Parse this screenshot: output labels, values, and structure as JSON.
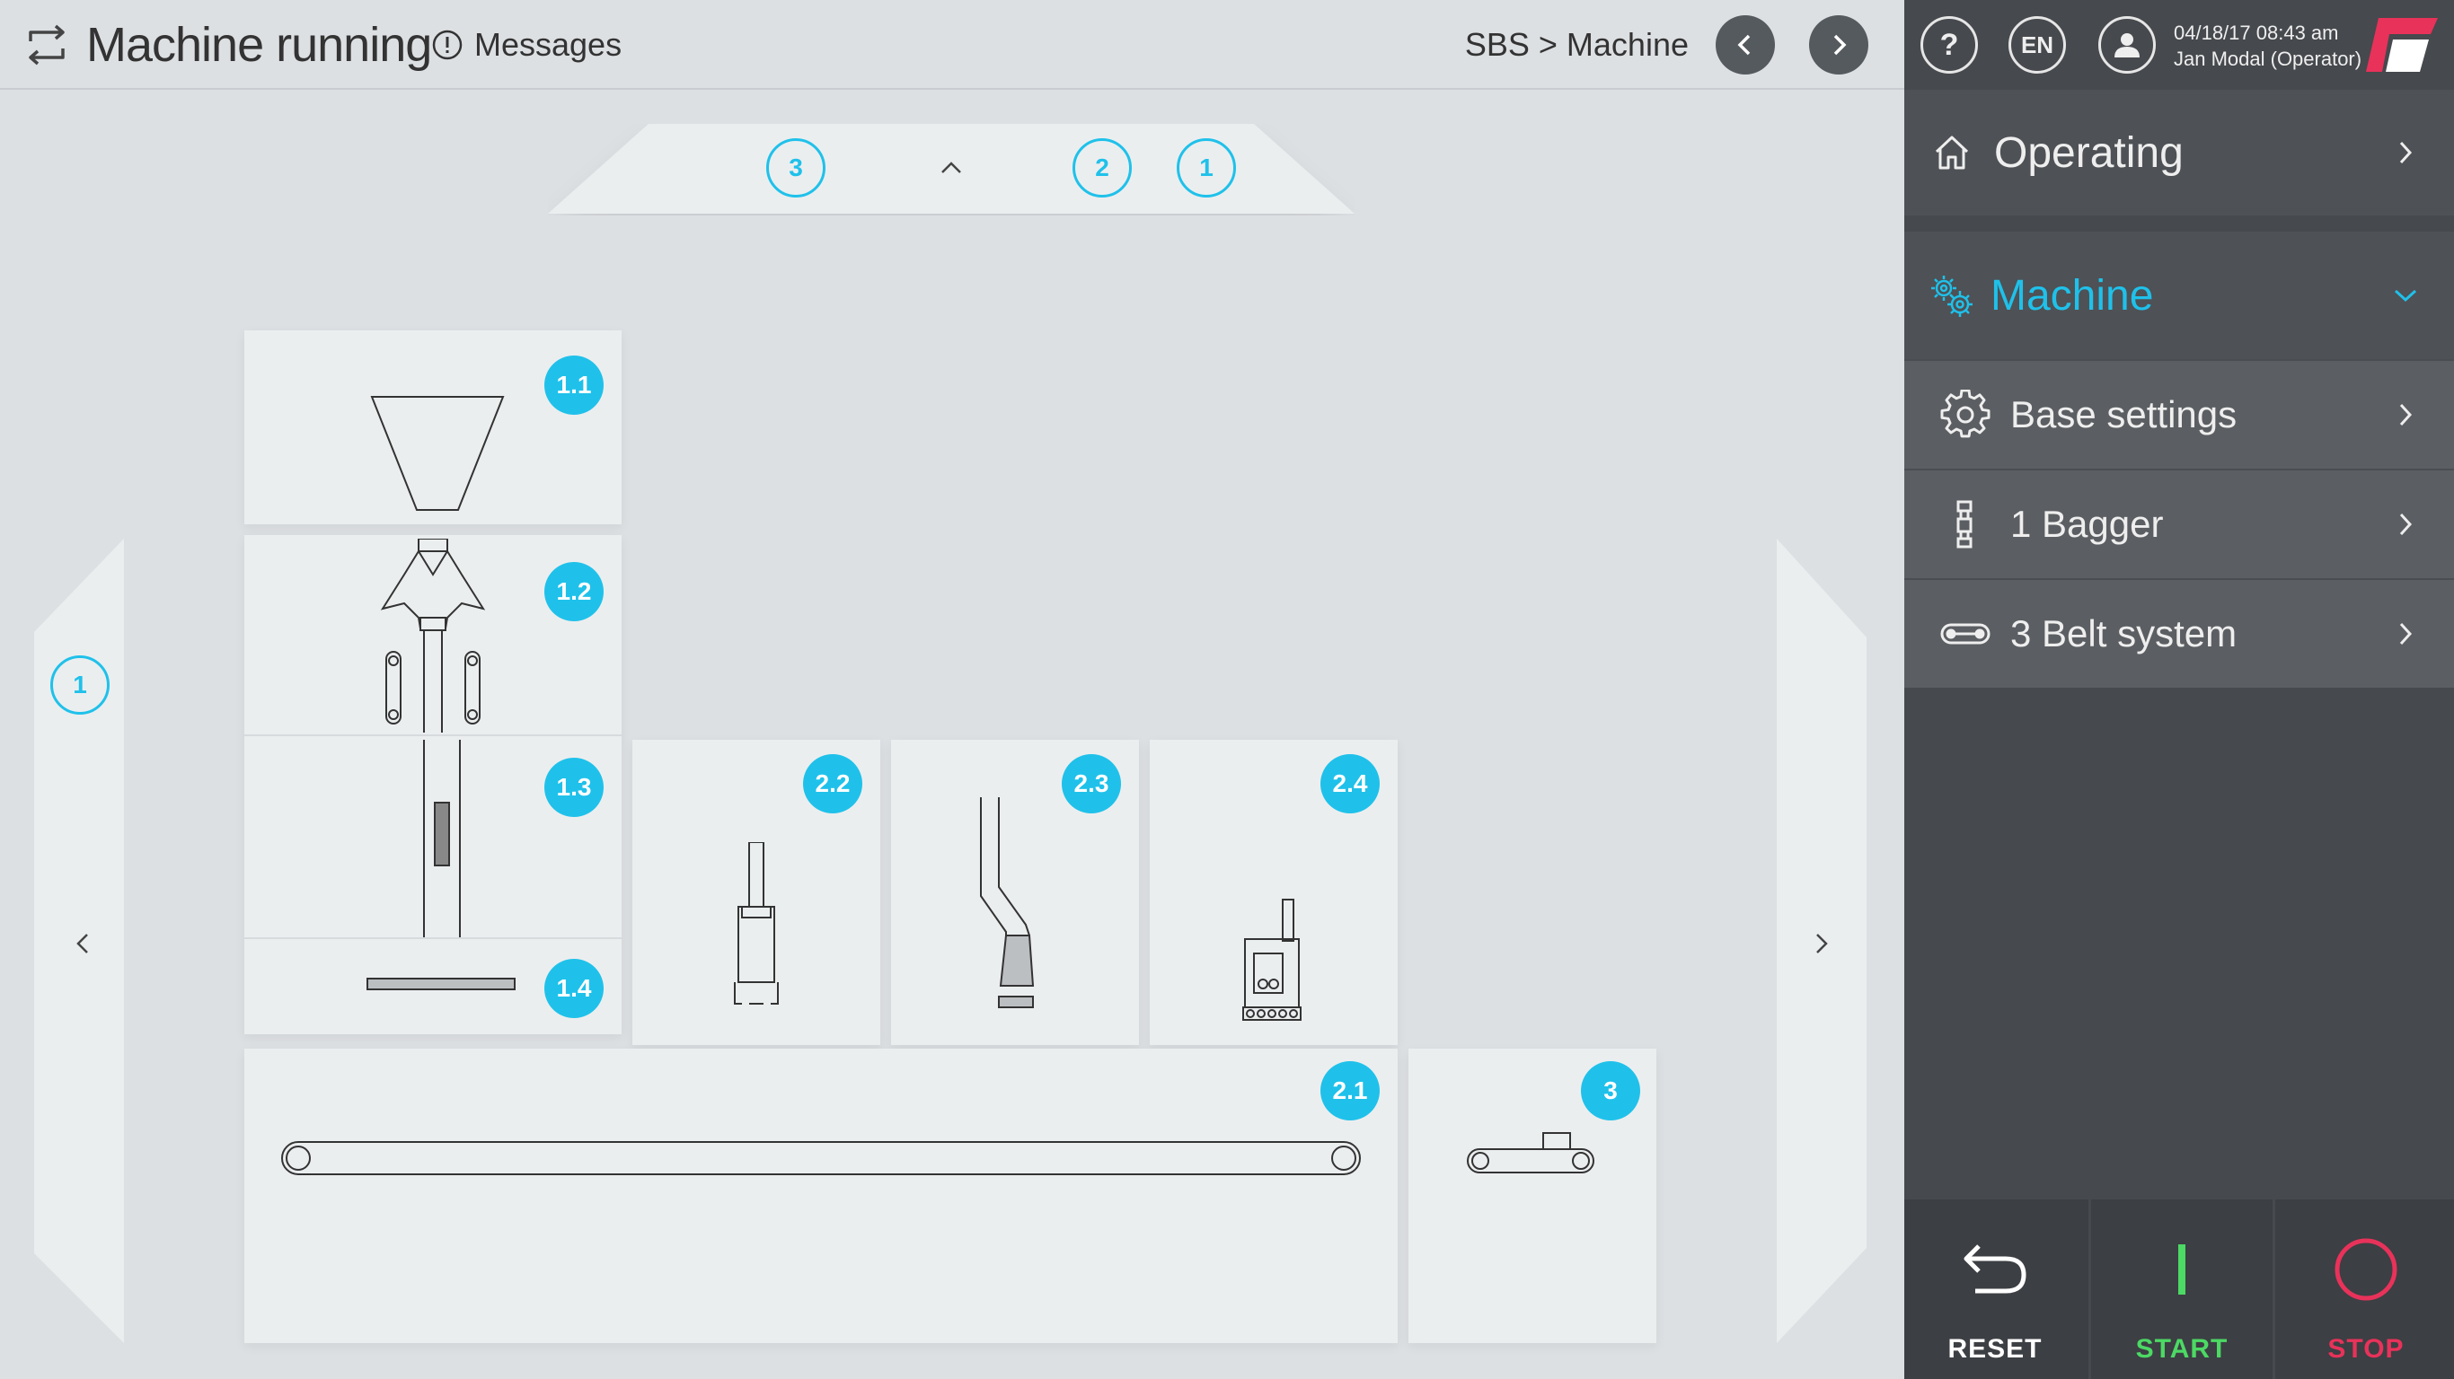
{
  "header": {
    "title": "Machine running",
    "messages_label": "Messages",
    "breadcrumb": "SBS > Machine"
  },
  "user": {
    "help_label": "?",
    "language": "EN",
    "datetime": "04/18/17 08:43 am",
    "name": "Jan Modal (Operator)"
  },
  "menu": {
    "operating": "Operating",
    "machine": "Machine",
    "items": [
      {
        "label": "Base settings",
        "icon": "gear-icon"
      },
      {
        "label": "1 Bagger",
        "icon": "bagger-icon"
      },
      {
        "label": "3 Belt system",
        "icon": "belt-icon"
      }
    ]
  },
  "actions": {
    "reset": "RESET",
    "start": "START",
    "stop": "STOP"
  },
  "trays": {
    "top_badges": [
      "3",
      "2",
      "1"
    ],
    "left_badge": "1"
  },
  "modules": {
    "m1_1": "1.1",
    "m1_2": "1.2",
    "m1_3": "1.3",
    "m1_4": "1.4",
    "m2_1": "2.1",
    "m2_2": "2.2",
    "m2_3": "2.3",
    "m2_4": "2.4",
    "m3": "3"
  },
  "colors": {
    "accent": "#1fc1ea",
    "start": "#4cd964",
    "stop": "#e8325a",
    "panel": "#46494d",
    "background": "#dde0e3"
  }
}
